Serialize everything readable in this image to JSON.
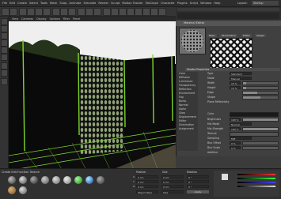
{
  "menubar": {
    "items": [
      "File",
      "Edit",
      "Create",
      "Select",
      "Tools",
      "Mesh",
      "Snap",
      "Animate",
      "Simulate",
      "Render",
      "Sculpt",
      "Motion Tracker",
      "MoGraph",
      "Character",
      "Plugins",
      "Script",
      "Window",
      "Help"
    ],
    "layout_label": "Layout:",
    "layout_value": "Startup"
  },
  "viewport": {
    "menu": [
      "View",
      "Cameras",
      "Display",
      "Options",
      "Filter",
      "Panel"
    ]
  },
  "material_editor": {
    "title": "Material Editor",
    "tabs": [
      "Basic",
      "Illumination",
      "Editor",
      "Assign"
    ],
    "section_header": "Shader Properties",
    "channels": [
      "Color",
      "Diffusion",
      "Luminance",
      "Transparency",
      "Reflection",
      "Environment",
      "Fog",
      "Bump",
      "Normal",
      "Alpha",
      "Glow",
      "Displacement",
      "Editor",
      "Illumination",
      "Assignment"
    ],
    "rows": [
      {
        "label": "Type",
        "value": "Standard"
      },
      {
        "label": "Mode",
        "value": "Manual"
      },
      {
        "label": "Width",
        "value": "10 %"
      },
      {
        "label": "Height",
        "value": "10 %"
      },
      {
        "label": "Edge",
        "value": ""
      },
      {
        "label": "Shape",
        "value": ""
      },
      {
        "label": "Plane Reflectivity",
        "value": ""
      },
      {
        "label": "Color",
        "value": ""
      },
      {
        "label": "Brightness",
        "value": "100 %"
      },
      {
        "label": "Mix Mode",
        "value": "Normal"
      },
      {
        "label": "Mix Strength",
        "value": "100 %"
      },
      {
        "label": "Texture",
        "value": ""
      },
      {
        "label": "Sampling",
        "value": "MIP"
      },
      {
        "label": "Blur Offset",
        "value": "0 %"
      },
      {
        "label": "Blur Scale",
        "value": "0 %"
      },
      {
        "label": "Additive",
        "value": ""
      }
    ]
  },
  "bottom": {
    "menu": [
      "Create",
      "Edit",
      "Function",
      "Texture"
    ],
    "coord_headers": [
      "Position",
      "Size",
      "Rotation"
    ],
    "coords": [
      {
        "axis": "X",
        "pos": "0 cm",
        "size": "0 cm",
        "rot": "0 °"
      },
      {
        "axis": "Y",
        "pos": "0 cm",
        "size": "0 cm",
        "rot": "0 °"
      },
      {
        "axis": "Z",
        "pos": "0 cm",
        "size": "0 cm",
        "rot": "0 °"
      }
    ],
    "object_mode": "Object (Rel)",
    "size_mode": "Size",
    "apply_label": "Apply"
  },
  "colors": {
    "fence_green": "#7fd62c",
    "sky": "#f2f2f2",
    "grass": "#4a6b2e",
    "background_panel": "#404040"
  }
}
